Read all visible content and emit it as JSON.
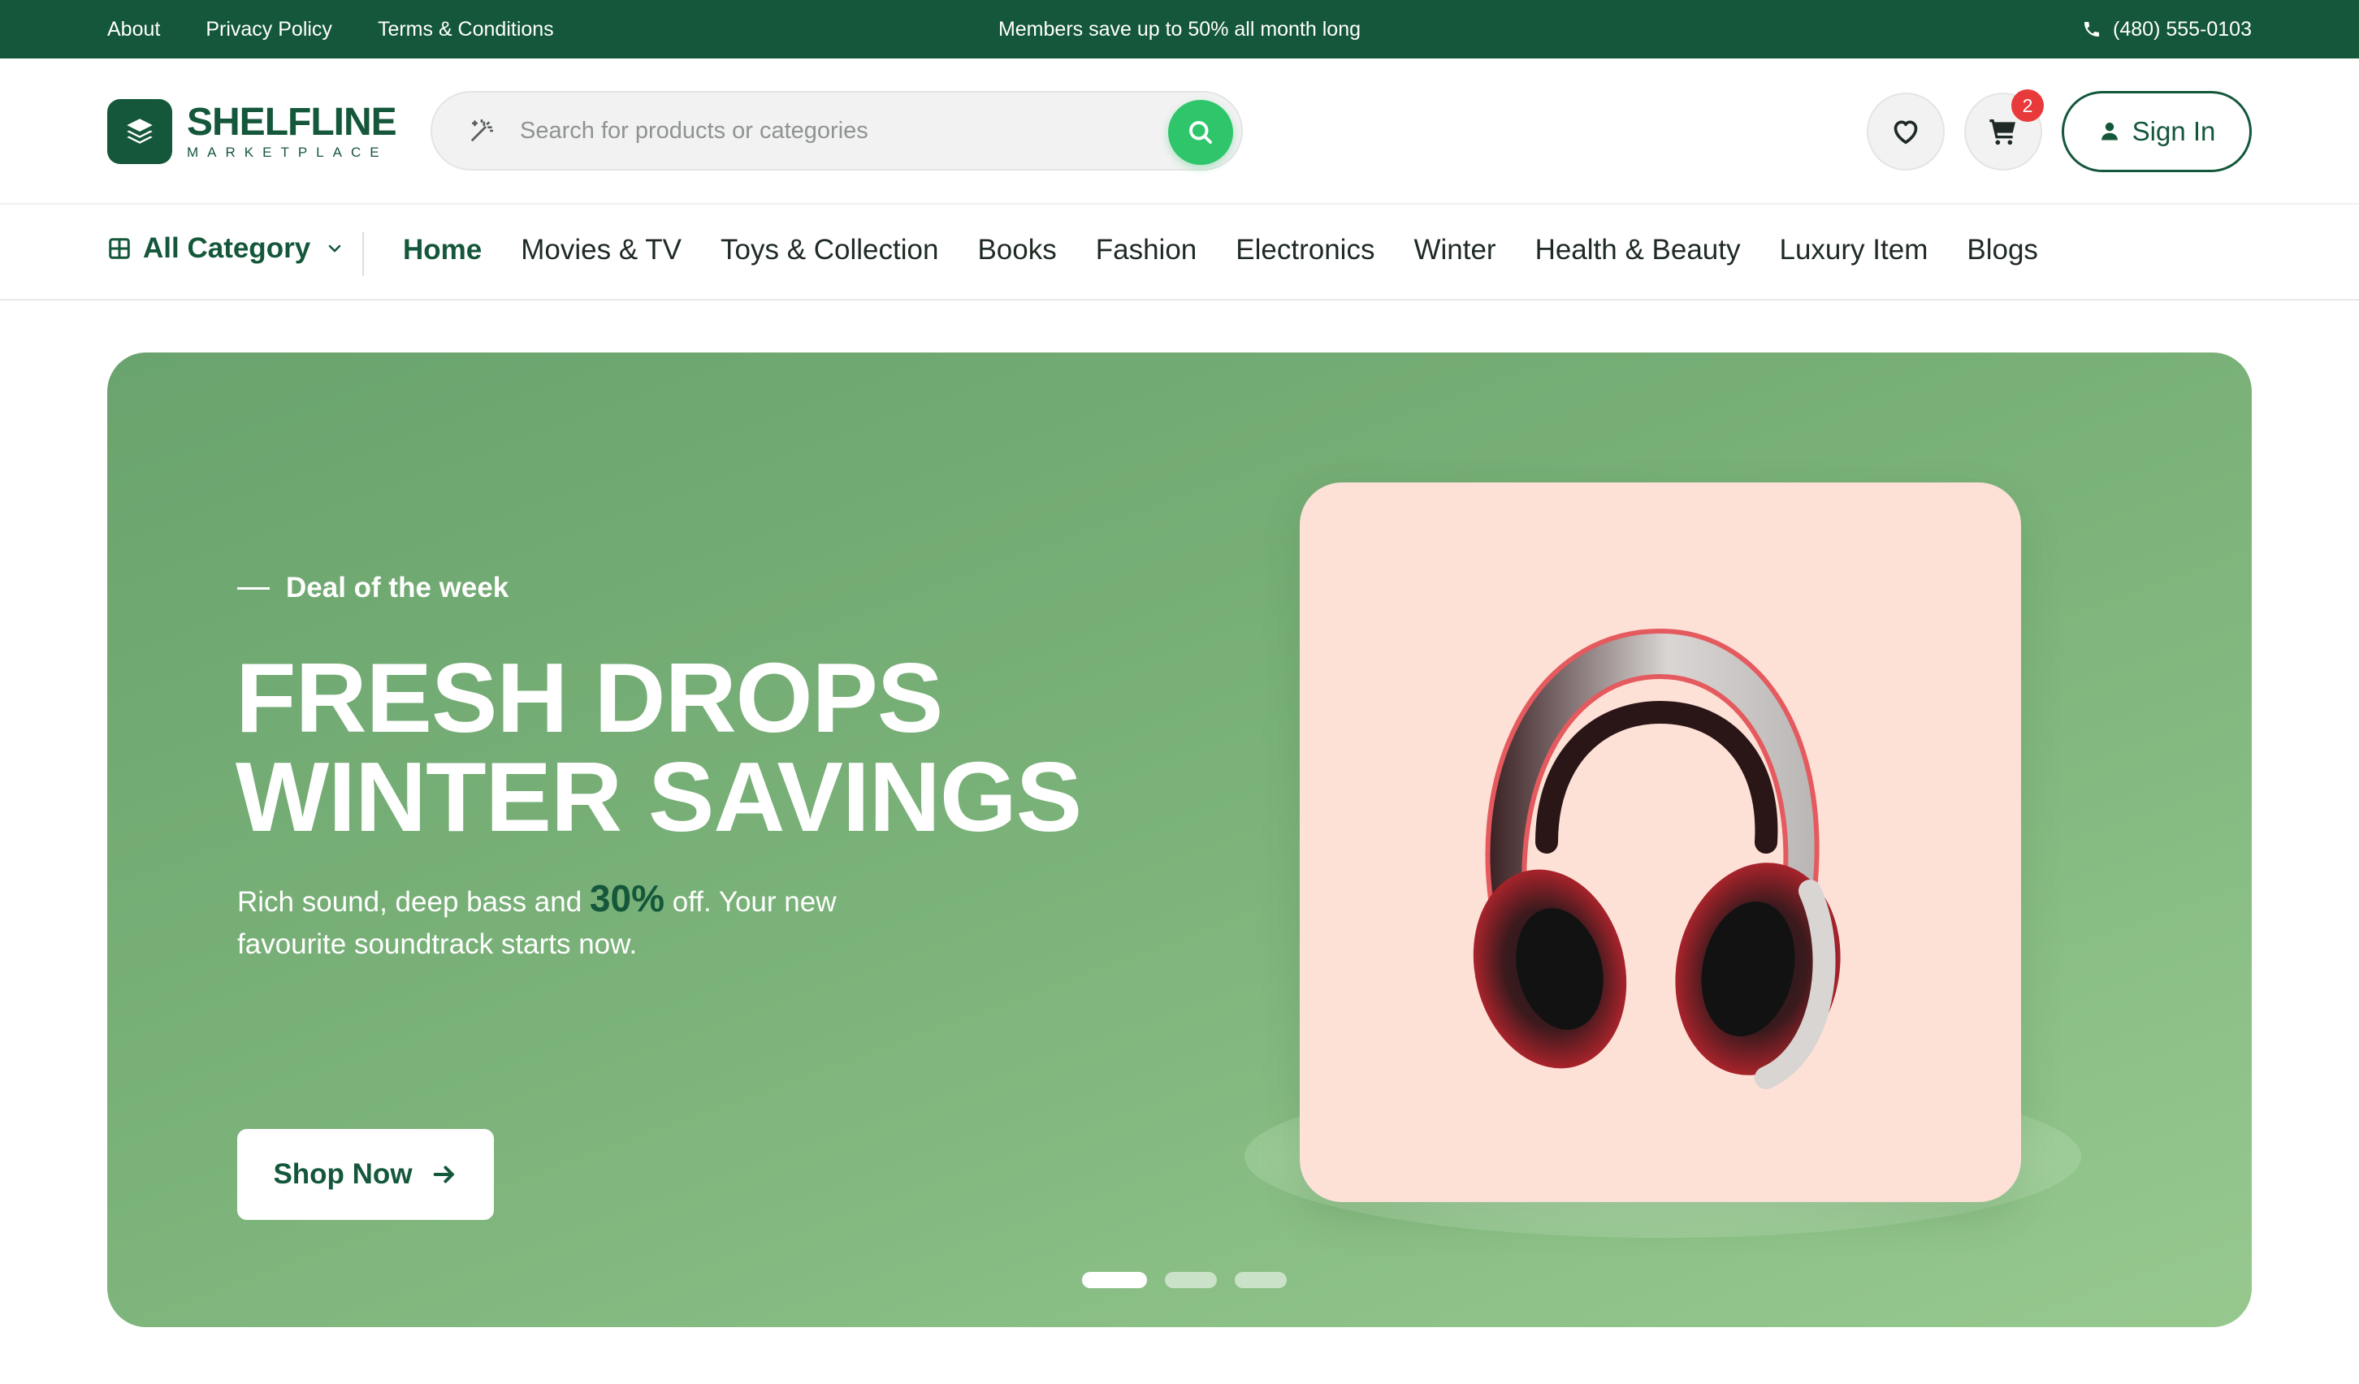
{
  "topbar": {
    "links": [
      "About",
      "Privacy Policy",
      "Terms & Conditions"
    ],
    "promo": "Members save up to 50% all month long",
    "phone": "(480) 555-0103"
  },
  "header": {
    "logo_name": "SHELFLINE",
    "logo_sub": "MARKETPLACE",
    "search_placeholder": "Search for products or categories",
    "cart_count": "2",
    "signin_label": "Sign In"
  },
  "nav": {
    "all_category": "All Category",
    "links": [
      "Home",
      "Movies & TV",
      "Toys & Collection",
      "Books",
      "Fashion",
      "Electronics",
      "Winter",
      "Health & Beauty",
      "Luxury Item",
      "Blogs"
    ],
    "active": "Home"
  },
  "hero": {
    "eyebrow": "Deal of the week",
    "title_line1": "FRESH DROPS",
    "title_line2": "WINTER SAVINGS",
    "desc_before": "Rich sound, deep bass and",
    "desc_highlight": "30%",
    "desc_after": "off. Your new favourite soundtrack starts now.",
    "cta": "Shop Now",
    "slides_total": 3,
    "slide_active": 1
  },
  "colors": {
    "brand": "#14573a",
    "accent": "#2fc56a",
    "badge": "#e83a3a",
    "hero_bg": "#7bb37a",
    "card_bg": "#fde0d6"
  },
  "icons": {
    "phone": "phone-icon",
    "logo": "layers-icon",
    "search_wand": "magic-wand-icon",
    "search": "search-icon",
    "wishlist": "heart-icon",
    "cart": "cart-icon",
    "user": "user-icon",
    "grid": "grid-icon",
    "chevron": "chevron-down-icon",
    "arrow": "arrow-right-icon"
  }
}
